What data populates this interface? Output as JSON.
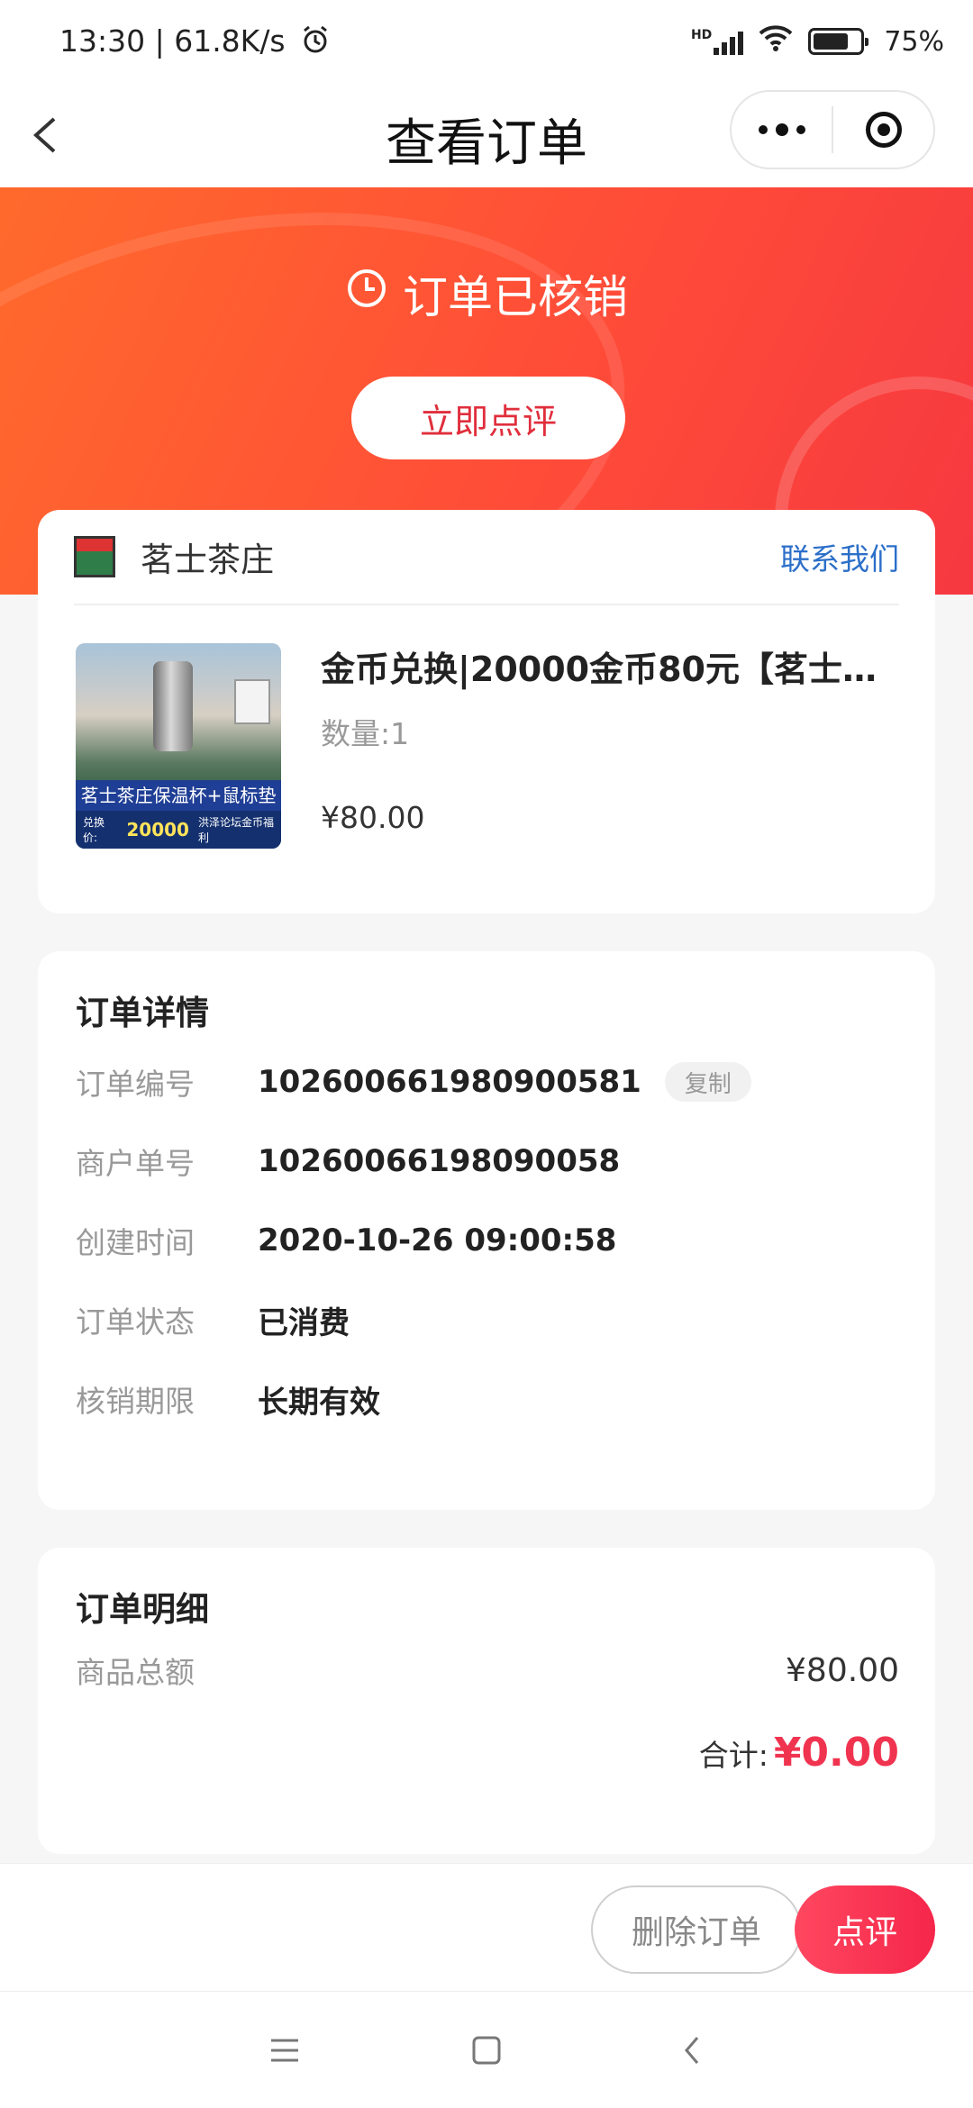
{
  "status_bar": {
    "time_speed": "13:30 | 61.8K/s",
    "network": "HD",
    "battery": "75%",
    "battery_level": 0.75
  },
  "nav": {
    "title": "查看订单"
  },
  "hero": {
    "status_text": "订单已核销",
    "review_now_label": "立即点评"
  },
  "shop": {
    "name": "茗士茶庄",
    "contact_label": "联系我们"
  },
  "product": {
    "title": "金币兑换|20000金币80元【茗士茶…",
    "quantity": "数量:1",
    "price": "¥80.00",
    "image": {
      "banner": "茗士茶庄保温杯+鼠标垫",
      "footer_prefix": "兑换价:",
      "footer_value": "20000",
      "footer_note": "洪泽论坛金币福利"
    }
  },
  "order_details": {
    "title": "订单详情",
    "copy_label": "复制",
    "rows": [
      {
        "label": "订单编号",
        "value": "102600661980900581"
      },
      {
        "label": "商户单号",
        "value": "10260066198090058"
      },
      {
        "label": "创建时间",
        "value": "2020-10-26 09:00:58"
      },
      {
        "label": "订单状态",
        "value": "已消费"
      },
      {
        "label": "核销期限",
        "value": "长期有效"
      }
    ]
  },
  "order_summary": {
    "title": "订单明细",
    "goods_total_label": "商品总额",
    "goods_total_value": "¥80.00",
    "total_label": "合计:",
    "total_value": "¥0.00"
  },
  "actions": {
    "delete_label": "删除订单",
    "review_label": "点评"
  },
  "colors": {
    "accent": "#f03450",
    "link": "#2c6fc9",
    "hero_start": "#ff6a2c",
    "hero_end": "#f63840"
  }
}
